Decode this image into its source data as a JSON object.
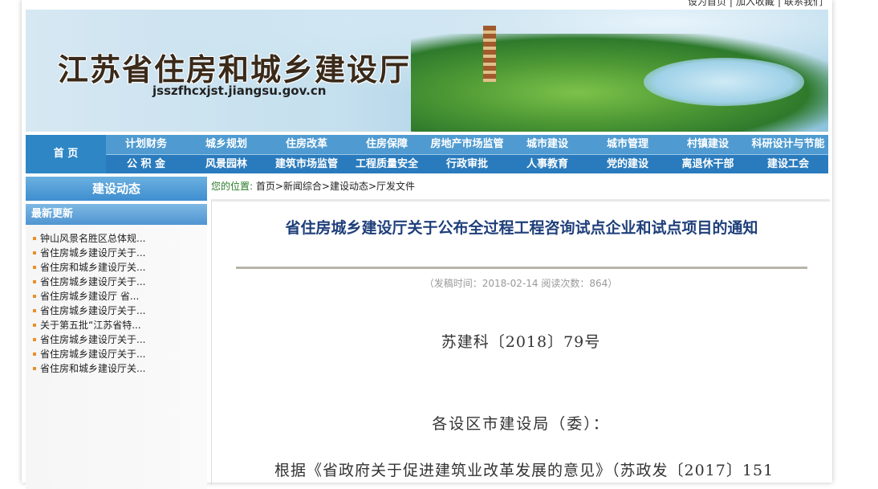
{
  "toplinks": {
    "set_home": "设为首页",
    "bookmark": "加入收藏",
    "contact": "联系我们",
    "separator": "|"
  },
  "banner": {
    "title": "江苏省住房和城乡建设厅",
    "url": "jsszfhcxjst.jiangsu.gov.cn"
  },
  "nav": {
    "home": "首 页",
    "row1": [
      "计划财务",
      "城乡规划",
      "住房改革",
      "住房保障",
      "房地产市场监管",
      "城市建设",
      "城市管理",
      "村镇建设",
      "科研设计与节能"
    ],
    "row2": [
      "公 积 金",
      "风景园林",
      "建筑市场监管",
      "工程质量安全",
      "行政审批",
      "人事教育",
      "党的建设",
      "离退休干部",
      "建设工会"
    ]
  },
  "sidebar": {
    "section_title": "建设动态",
    "latest_title": "最新更新",
    "items": [
      "钟山风景名胜区总体规...",
      "省住房城乡建设厅关于...",
      "省住房和城乡建设厅关...",
      "省住房城乡建设厅关于...",
      "省住房城乡建设厅 省...",
      "省住房城乡建设厅关于...",
      "关于第五批“江苏省特...",
      "省住房城乡建设厅关于...",
      "省住房城乡建设厅关于...",
      "省住房和城乡建设厅关..."
    ]
  },
  "breadcrumb": {
    "label": "您的位置:",
    "path": "首页>新闻综合>建设动态>厅发文件"
  },
  "article": {
    "title": "省住房城乡建设厅关于公布全过程工程咨询试点企业和试点项目的通知",
    "meta": "（发稿时间：2018-02-14 阅读次数：864）",
    "doc_number": "苏建科〔2018〕79号",
    "recipient": "各设区市建设局（委）：",
    "body_start": "根据《省政府关于促进建筑业改革发展的意见》（苏政发〔2017〕151"
  },
  "colors": {
    "nav_row1": "#4f9bd1",
    "nav_row2": "#2a7bbd",
    "title": "#1f3f7a",
    "bullet": "#e8902a"
  }
}
